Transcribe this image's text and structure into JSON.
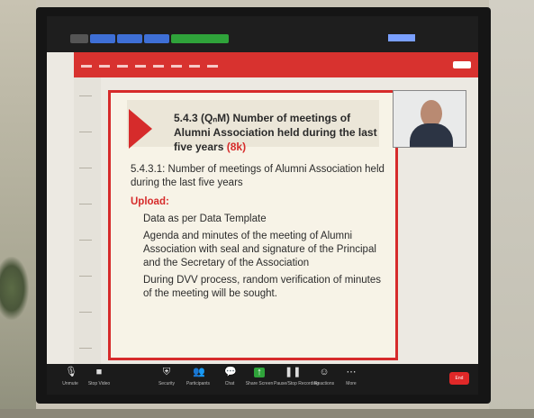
{
  "slide": {
    "title_main": "5.4.3 (QₙM) Number of meetings of Alumni Association held during the last five years",
    "title_tag": "(8k)",
    "bullet": "5.4.3.1: Number of meetings of Alumni Association held during the last five years",
    "upload_heading": "Upload:",
    "items": [
      "Data as per Data Template",
      "Agenda and minutes of the meeting of Alumni Association with seal and signature of the Principal and the Secretary of the Association",
      "During DVV process, random verification of minutes of the meeting will be sought."
    ]
  },
  "video_tile": {
    "name": "",
    "present": true
  },
  "zoom_toolbar": {
    "items": [
      {
        "icon": "microphone-icon",
        "label": "Unmute"
      },
      {
        "icon": "video-camera-icon",
        "label": "Stop Video"
      },
      {
        "icon": "shield-icon",
        "label": "Security"
      },
      {
        "icon": "participants-icon",
        "label": "Participants"
      },
      {
        "icon": "chat-icon",
        "label": "Chat"
      },
      {
        "icon": "share-screen-icon",
        "label": "Share Screen"
      },
      {
        "icon": "record-icon",
        "label": "Pause/Stop Recording"
      },
      {
        "icon": "reactions-icon",
        "label": "Reactions"
      },
      {
        "icon": "more-icon",
        "label": "More"
      }
    ],
    "end_label": "End"
  },
  "colors": {
    "slide_accent": "#d62b2b",
    "ribbon": "#d8322f",
    "zoom_bg": "#1b1b1b"
  }
}
